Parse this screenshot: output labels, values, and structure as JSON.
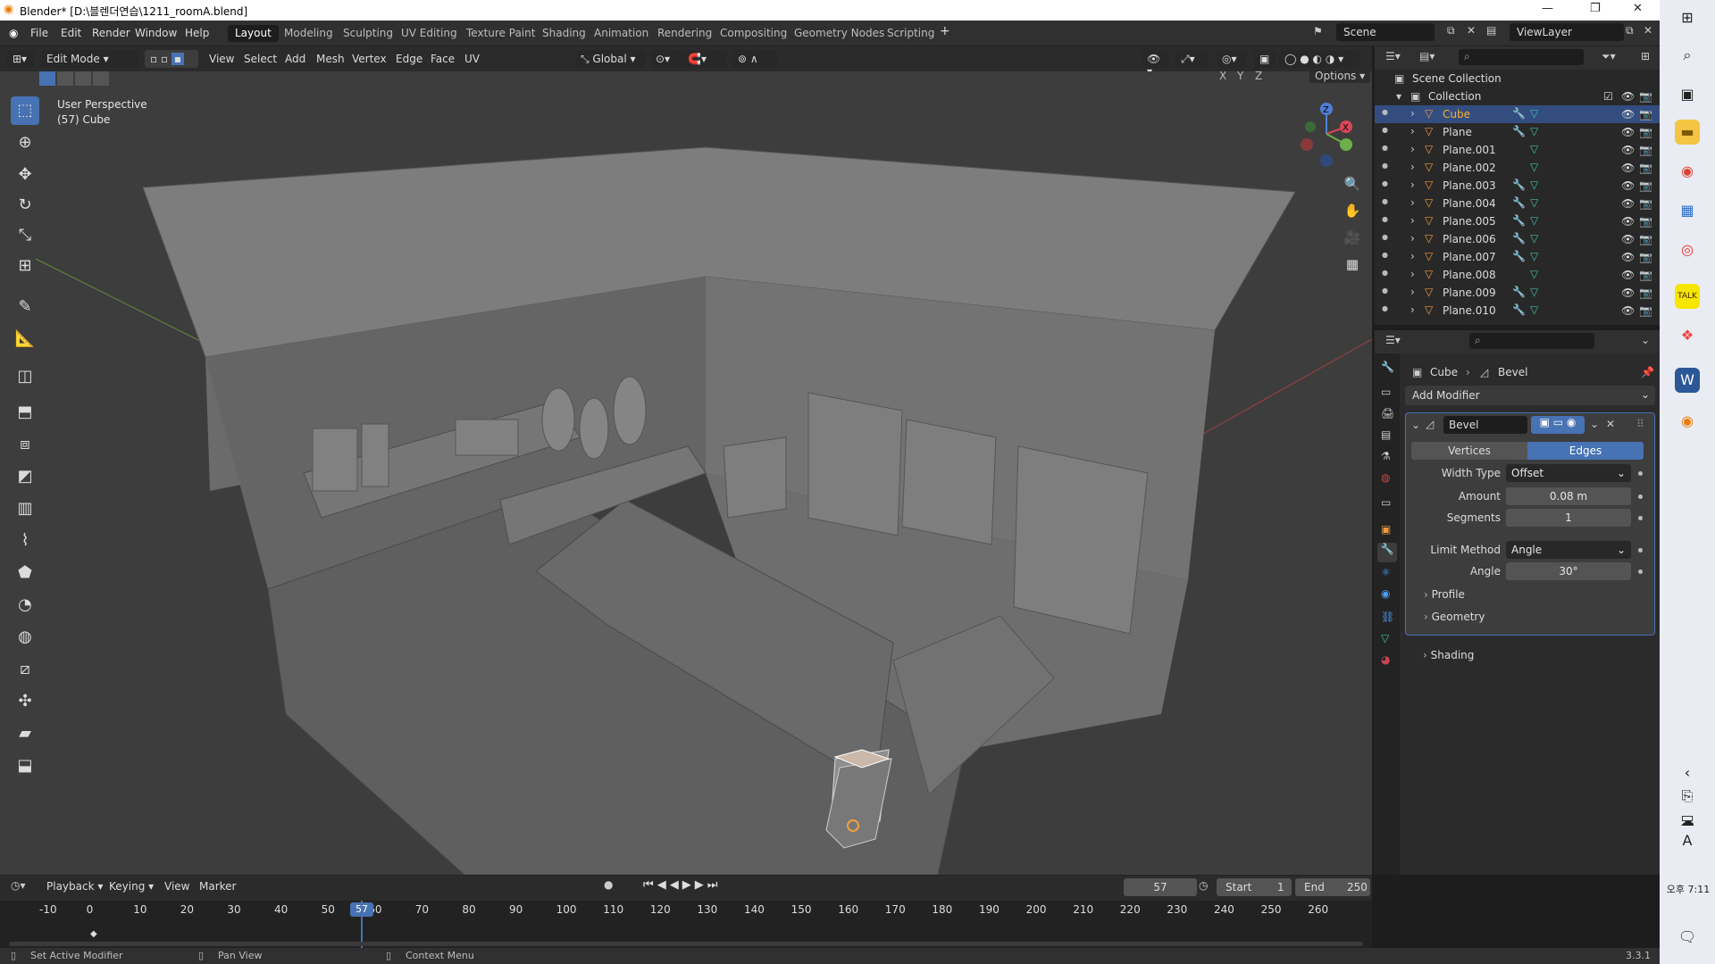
{
  "window": {
    "title": "Blender* [D:\\블렌더연습\\1211_roomA.blend]"
  },
  "menus": [
    "File",
    "Edit",
    "Render",
    "Window",
    "Help"
  ],
  "workspaces": [
    "Layout",
    "Modeling",
    "Sculpting",
    "UV Editing",
    "Texture Paint",
    "Shading",
    "Animation",
    "Rendering",
    "Compositing",
    "Geometry Nodes",
    "Scripting"
  ],
  "active_workspace": "Layout",
  "scene": "Scene",
  "view_layer": "ViewLayer",
  "viewport_header": {
    "mode": "Edit Mode",
    "menus": [
      "View",
      "Select",
      "Add",
      "Mesh",
      "Vertex",
      "Edge",
      "Face",
      "UV"
    ],
    "transform_orientation": "Global",
    "axes": [
      "X",
      "Y",
      "Z"
    ],
    "options": "Options"
  },
  "viewport": {
    "line1": "User Perspective",
    "line2": "(57) Cube"
  },
  "outliner": {
    "root": "Scene Collection",
    "collection": "Collection",
    "objects": [
      "Cube",
      "Plane",
      "Plane.001",
      "Plane.002",
      "Plane.003",
      "Plane.004",
      "Plane.005",
      "Plane.006",
      "Plane.007",
      "Plane.008",
      "Plane.009",
      "Plane.010"
    ],
    "selected": "Cube"
  },
  "properties": {
    "breadcrumb_object": "Cube",
    "breadcrumb_modifier": "Bevel",
    "add_modifier": "Add Modifier",
    "modifier_name": "Bevel",
    "tabs": [
      "Vertices",
      "Edges"
    ],
    "active_tab": "Edges",
    "fields": [
      {
        "label": "Width Type",
        "value": "Offset",
        "type": "dropdown"
      },
      {
        "label": "Amount",
        "value": "0.08 m",
        "type": "number"
      },
      {
        "label": "Segments",
        "value": "1",
        "type": "number"
      },
      {
        "label": "Limit Method",
        "value": "Angle",
        "type": "dropdown"
      },
      {
        "label": "Angle",
        "value": "30°",
        "type": "number"
      }
    ],
    "panels": [
      "Profile",
      "Geometry",
      "Shading"
    ]
  },
  "timeline": {
    "menus": [
      "Playback",
      "Keying",
      "View",
      "Marker"
    ],
    "current_frame": "57",
    "start_label": "Start",
    "start": "1",
    "end_label": "End",
    "end": "250",
    "ticks": [
      "-10",
      "0",
      "10",
      "20",
      "30",
      "40",
      "50",
      "60",
      "70",
      "80",
      "90",
      "100",
      "110",
      "120",
      "130",
      "140",
      "150",
      "160",
      "170",
      "180",
      "190",
      "200",
      "210",
      "220",
      "230",
      "240",
      "250",
      "260"
    ]
  },
  "statusbar": {
    "left": "Set Active Modifier",
    "mid": "Pan View",
    "right": "Context Menu",
    "version": "3.3.1"
  },
  "taskbar": {
    "time_label": "오후 7:11",
    "lang": "A"
  },
  "colors": {
    "accent": "#4772b3",
    "selected_row": "#334d80",
    "object_icon": "#f09a3e",
    "mesh_icon": "#3cbfa7",
    "active_object": "#ffaf29"
  }
}
